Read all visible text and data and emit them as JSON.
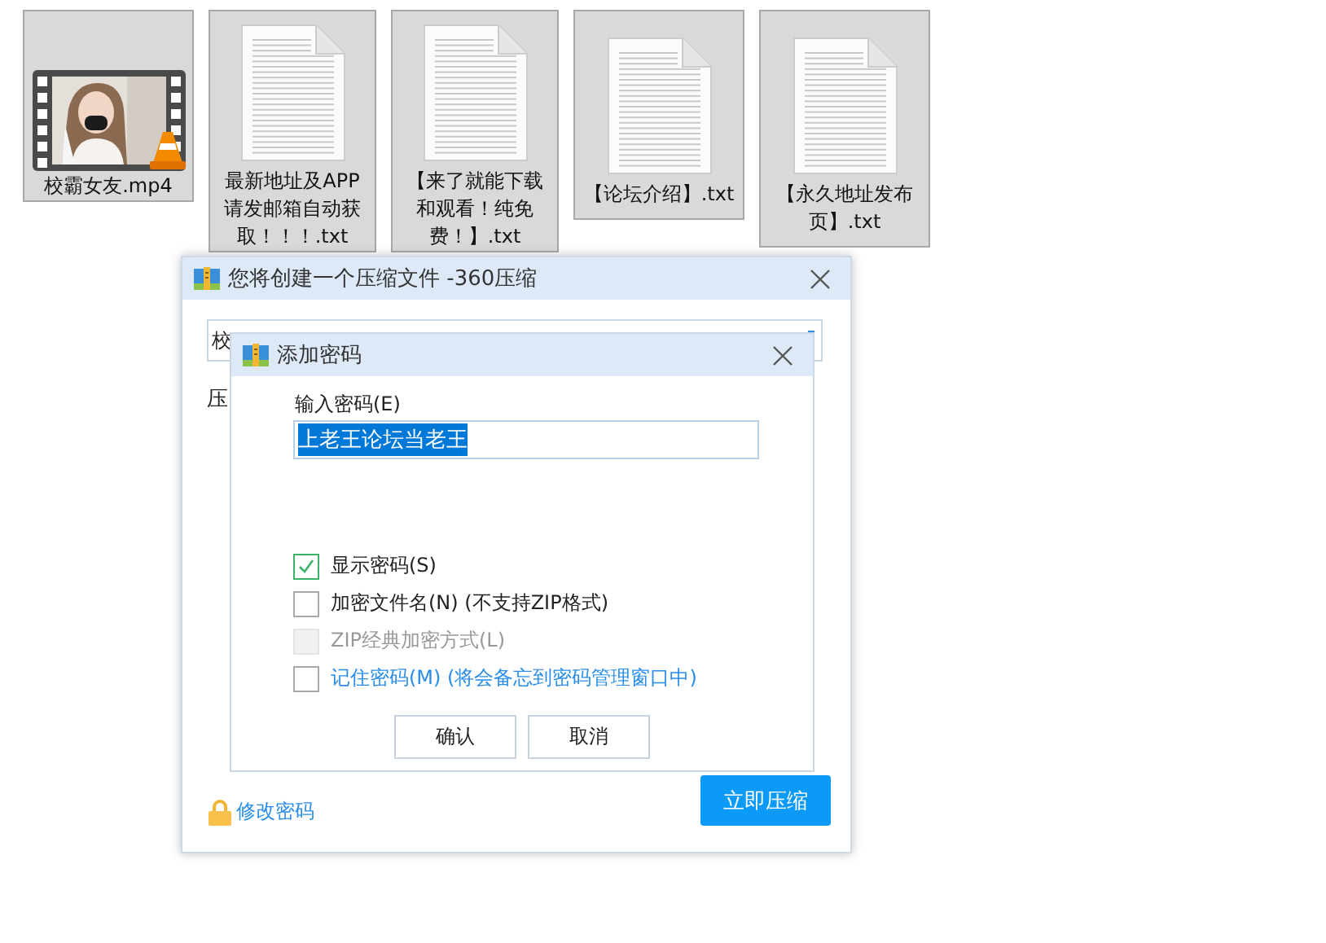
{
  "files": [
    {
      "kind": "video",
      "lines": [
        "校霸女友.mp4"
      ]
    },
    {
      "kind": "text",
      "lines": [
        "最新地址及APP",
        "请发邮箱自动获",
        "取！！！.txt"
      ]
    },
    {
      "kind": "text",
      "lines": [
        "【来了就能下载",
        "和观看！纯免",
        "费！】.txt"
      ]
    },
    {
      "kind": "text",
      "lines": [
        "【论坛介绍】.txt"
      ]
    },
    {
      "kind": "text",
      "lines": [
        "【永久地址发布",
        "页】.txt"
      ]
    }
  ],
  "main_dialog": {
    "title": "您将创建一个压缩文件 -360压缩",
    "field_value": "校",
    "label": "压",
    "change_password_link": "修改密码",
    "compress_button": "立即压缩"
  },
  "password_dialog": {
    "title": "添加密码",
    "password_label": "输入密码(E)",
    "password_value": "上老王论坛当老王",
    "value_highlighted": true,
    "options": [
      {
        "label": "显示密码(S)",
        "checked": true,
        "disabled": false,
        "kind": "plain"
      },
      {
        "label": "加密文件名(N) (不支持ZIP格式)",
        "checked": false,
        "disabled": false,
        "kind": "plain"
      },
      {
        "label": "ZIP经典加密方式(L)",
        "checked": false,
        "disabled": true,
        "kind": "plain"
      },
      {
        "label": "记住密码(M) (将会备忘到密码管理窗口中)",
        "checked": false,
        "disabled": false,
        "kind": "info"
      }
    ],
    "buttons": [
      "确认",
      "取消"
    ]
  }
}
